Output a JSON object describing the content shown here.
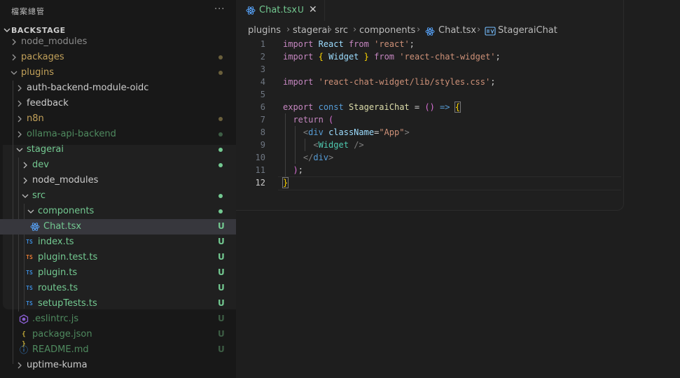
{
  "sidebar": {
    "title": "檔案總管",
    "more": "···",
    "section": "BACKSTAGE",
    "rows": [
      {
        "name": "node_modules",
        "badge": "",
        "dot": false
      },
      {
        "name": "packages",
        "badge": "",
        "dot": true
      },
      {
        "name": "plugins",
        "badge": "",
        "dot": true
      },
      {
        "name": "auth-backend-module-oidc",
        "badge": "",
        "dot": false
      },
      {
        "name": "feedback",
        "badge": "",
        "dot": false
      },
      {
        "name": "n8n",
        "badge": "",
        "dot": true
      },
      {
        "name": "ollama-api-backend",
        "badge": "",
        "dot": true
      },
      {
        "name": "stagerai",
        "badge": "",
        "dot": true
      },
      {
        "name": "dev",
        "badge": "",
        "dot": true
      },
      {
        "name": "node_modules",
        "badge": "",
        "dot": false
      },
      {
        "name": "src",
        "badge": "",
        "dot": true
      },
      {
        "name": "components",
        "badge": "",
        "dot": true
      },
      {
        "name": "Chat.tsx",
        "badge": "U",
        "dot": false
      },
      {
        "name": "index.ts",
        "badge": "U",
        "dot": false
      },
      {
        "name": "plugin.test.ts",
        "badge": "U",
        "dot": false
      },
      {
        "name": "plugin.ts",
        "badge": "U",
        "dot": false
      },
      {
        "name": "routes.ts",
        "badge": "U",
        "dot": false
      },
      {
        "name": "setupTests.ts",
        "badge": "U",
        "dot": false
      },
      {
        "name": ".eslintrc.js",
        "badge": "U",
        "dot": false
      },
      {
        "name": "package.json",
        "badge": "U",
        "dot": false
      },
      {
        "name": "README.md",
        "badge": "U",
        "dot": false
      },
      {
        "name": "uptime-kuma",
        "badge": "",
        "dot": false
      }
    ],
    "icons": {
      "ts": "TS",
      "json": "{ }",
      "info": "ⓘ"
    }
  },
  "tab": {
    "name": "Chat.tsx",
    "badge": "U",
    "close": "✕"
  },
  "breadcrumb": [
    "plugins",
    "stagerai",
    "src",
    "components",
    "Chat.tsx",
    "StageraiChat"
  ],
  "code": {
    "line_numbers": [
      "1",
      "2",
      "3",
      "4",
      "5",
      "6",
      "7",
      "8",
      "9",
      "10",
      "11",
      "12"
    ],
    "l1": {
      "a": "import",
      "b": "React",
      "c": "from",
      "d": "'react'",
      "e": ";"
    },
    "l2": {
      "a": "import",
      "b": "{",
      "c": "Widget",
      "d": "}",
      "e": "from",
      "f": "'react-chat-widget'",
      "g": ";"
    },
    "l4": {
      "a": "import",
      "b": "'react-chat-widget/lib/styles.css'",
      "c": ";"
    },
    "l6": {
      "a": "export",
      "b": "const",
      "c": "StageraiChat",
      "d": "=",
      "e": "()",
      "f": "=>",
      "g": "{"
    },
    "l7": {
      "a": "return",
      "b": "("
    },
    "l8": {
      "a": "<",
      "b": "div",
      "c": "className",
      "d": "=",
      "e": "\"App\"",
      "f": ">"
    },
    "l9": {
      "a": "<",
      "b": "Widget",
      "c": "/>"
    },
    "l10": {
      "a": "</",
      "b": "div",
      "c": ">"
    },
    "l11": {
      "a": ")",
      "b": ";"
    },
    "l12": {
      "a": "}"
    }
  },
  "colors": {
    "untracked": "#73c991",
    "modified_dot": "#6a5f3b",
    "accent": "#007acc"
  }
}
